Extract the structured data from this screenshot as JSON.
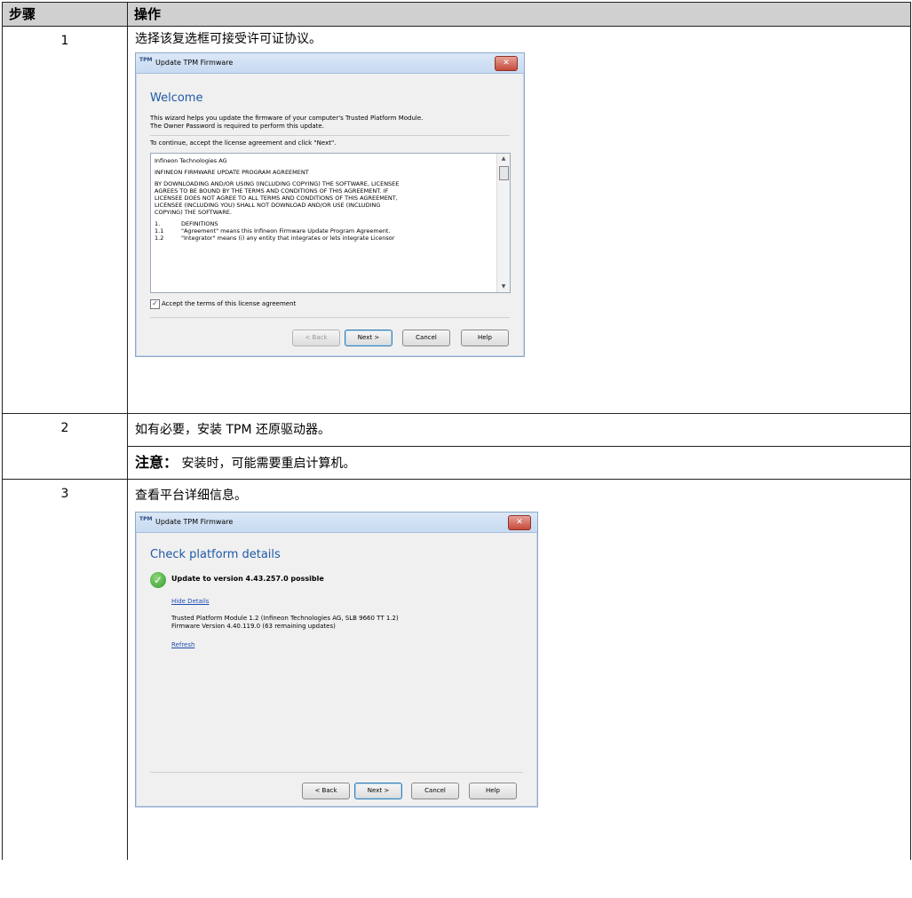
{
  "table": {
    "header": {
      "step": "步骤",
      "action": "操作"
    },
    "rows": [
      {
        "step": "1",
        "action": "选择该复选框可接受许可证协议。"
      },
      {
        "step": "2",
        "action": "如有必要，安装 TPM 还原驱动器。",
        "note_label": "注意：",
        "note_text": "安装时，可能需要重启计算机。"
      },
      {
        "step": "3",
        "action": "查看平台详细信息。"
      }
    ]
  },
  "dialog1": {
    "icon_text": "TPM",
    "title": "Update TPM Firmware",
    "close_glyph": "✕",
    "heading": "Welcome",
    "intro1": "This wizard helps you update the firmware of your computer's Trusted Platform Module.",
    "intro2": "The Owner Password is required to perform this update.",
    "instruction": "To continue, accept the license agreement and click \"Next\".",
    "license": {
      "company": "Infineon Technologies AG",
      "agreement_title": "INFINEON FIRMWARE UPDATE PROGRAM AGREEMENT",
      "body1": "BY DOWNLOADING AND/OR USING (INCLUDING COPYING) THE SOFTWARE, LICENSEE",
      "body2": "AGREES TO BE BOUND BY THE TERMS AND CONDITIONS OF THIS AGREEMENT. IF",
      "body3": "LICENSEE DOES NOT AGREE TO ALL TERMS AND CONDITIONS OF THIS AGREEMENT,",
      "body4": "LICENSEE (INCLUDING YOU) SHALL NOT DOWNLOAD AND/OR USE (INCLUDING",
      "body5": "COPYING) THE SOFTWARE.",
      "def_num": "1.",
      "def_title": "DEFINITIONS",
      "def11_num": "1.1",
      "def11": "\"Agreement\" means this Infineon Firmware Update Program Agreement.",
      "def12_num": "1.2",
      "def12": "\"Integrator\" means (i) any entity that integrates or lets integrate Licensor"
    },
    "accept_label": "Accept the terms of this license agreement",
    "accept_checked": true,
    "buttons": {
      "back": "< Back",
      "next": "Next >",
      "cancel": "Cancel",
      "help": "Help"
    }
  },
  "dialog2": {
    "icon_text": "TPM",
    "title": "Update TPM Firmware",
    "close_glyph": "✕",
    "heading": "Check platform details",
    "status": "Update to version 4.43.257.0 possible",
    "hide_details": "Hide Details",
    "detail1": "Trusted Platform Module 1.2 (Infineon Technologies AG, SLB 9660 TT 1.2)",
    "detail2": "Firmware Version 4.40.119.0 (63 remaining updates)",
    "refresh": "Refresh",
    "buttons": {
      "back": "< Back",
      "next": "Next >",
      "cancel": "Cancel",
      "help": "Help"
    }
  }
}
